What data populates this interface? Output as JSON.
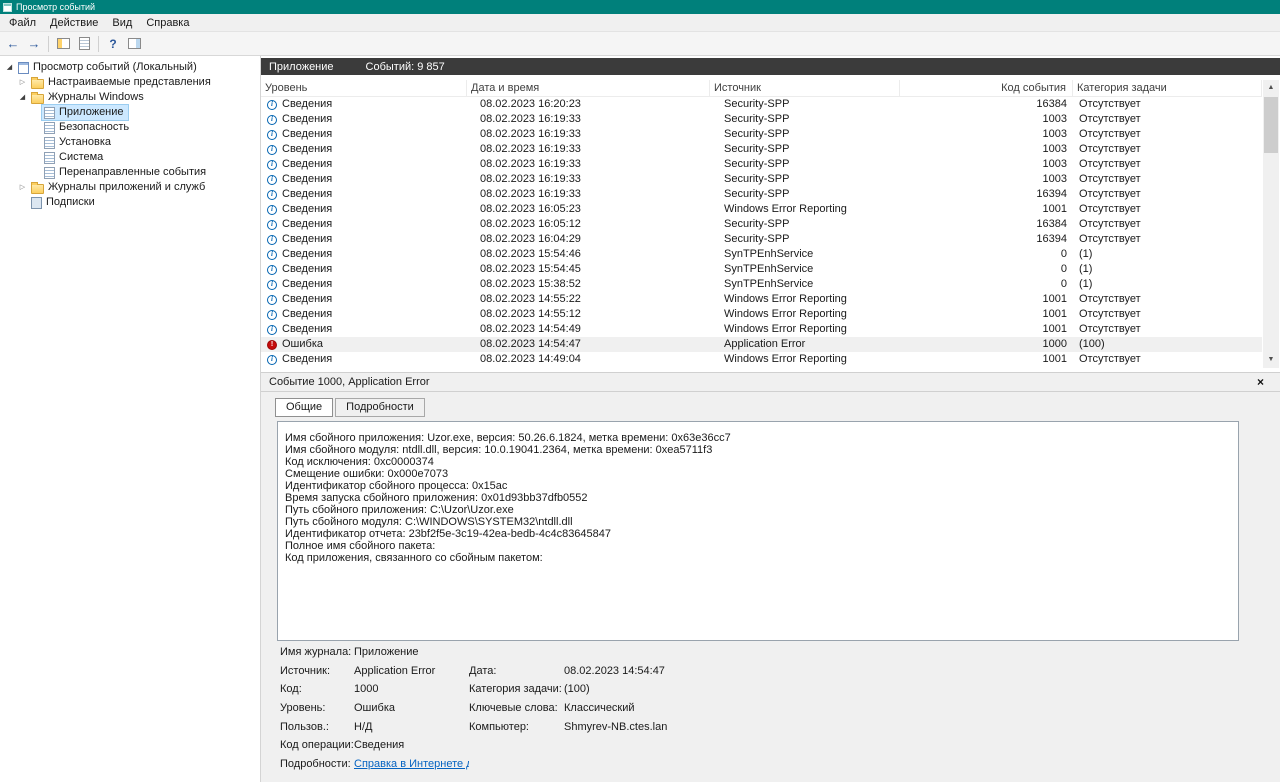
{
  "window": {
    "title": "Просмотр событий"
  },
  "colors": {
    "titlebar": "#00807b",
    "log_header_bar": "#3b3b3b",
    "tree_selection": "#cce8ff",
    "row_selection": "#f0f0f0",
    "link": "#0563c1",
    "error_icon": "#c50b0b",
    "info_icon": "#0063b1"
  },
  "menu": {
    "items": [
      {
        "id": "file",
        "label": "Файл"
      },
      {
        "id": "action",
        "label": "Действие"
      },
      {
        "id": "view",
        "label": "Вид"
      },
      {
        "id": "help",
        "label": "Справка"
      }
    ]
  },
  "toolbar": {
    "buttons": [
      "back",
      "forward",
      "show-console-tree",
      "properties",
      "help",
      "action-pane"
    ]
  },
  "sidebar": {
    "items": [
      {
        "id": "root",
        "label": "Просмотр событий (Локальный)",
        "indent": 0,
        "expander": "expanded",
        "icon": "event-viewer",
        "selected": false
      },
      {
        "id": "custom-views",
        "label": "Настраиваемые представления",
        "indent": 1,
        "expander": "collapsed",
        "icon": "folder",
        "selected": false
      },
      {
        "id": "windows-logs",
        "label": "Журналы Windows",
        "indent": 1,
        "expander": "expanded",
        "icon": "folder",
        "selected": false
      },
      {
        "id": "application",
        "label": "Приложение",
        "indent": 2,
        "expander": "none",
        "icon": "log",
        "selected": true
      },
      {
        "id": "security",
        "label": "Безопасность",
        "indent": 2,
        "expander": "none",
        "icon": "log",
        "selected": false
      },
      {
        "id": "setup",
        "label": "Установка",
        "indent": 2,
        "expander": "none",
        "icon": "log",
        "selected": false
      },
      {
        "id": "system",
        "label": "Система",
        "indent": 2,
        "expander": "none",
        "icon": "log",
        "selected": false
      },
      {
        "id": "forwarded-events",
        "label": "Перенаправленные события",
        "indent": 2,
        "expander": "none",
        "icon": "log",
        "selected": false
      },
      {
        "id": "apps-services-logs",
        "label": "Журналы приложений и служб",
        "indent": 1,
        "expander": "collapsed",
        "icon": "folder",
        "selected": false
      },
      {
        "id": "subscriptions",
        "label": "Подписки",
        "indent": 1,
        "expander": "none",
        "icon": "subscriptions",
        "selected": false
      }
    ]
  },
  "main": {
    "log_title": "Приложение",
    "events_count": "Событий: 9 857",
    "columns": [
      "Уровень",
      "Дата и время",
      "Источник",
      "Код события",
      "Категория задачи"
    ],
    "rows": [
      {
        "level": "Сведения",
        "icon": "info",
        "datetime": "08.02.2023 16:20:23",
        "source": "Security-SPP",
        "event_id": "16384",
        "category": "Отсутствует",
        "selected": false
      },
      {
        "level": "Сведения",
        "icon": "info",
        "datetime": "08.02.2023 16:19:33",
        "source": "Security-SPP",
        "event_id": "1003",
        "category": "Отсутствует",
        "selected": false
      },
      {
        "level": "Сведения",
        "icon": "info",
        "datetime": "08.02.2023 16:19:33",
        "source": "Security-SPP",
        "event_id": "1003",
        "category": "Отсутствует",
        "selected": false
      },
      {
        "level": "Сведения",
        "icon": "info",
        "datetime": "08.02.2023 16:19:33",
        "source": "Security-SPP",
        "event_id": "1003",
        "category": "Отсутствует",
        "selected": false
      },
      {
        "level": "Сведения",
        "icon": "info",
        "datetime": "08.02.2023 16:19:33",
        "source": "Security-SPP",
        "event_id": "1003",
        "category": "Отсутствует",
        "selected": false
      },
      {
        "level": "Сведения",
        "icon": "info",
        "datetime": "08.02.2023 16:19:33",
        "source": "Security-SPP",
        "event_id": "1003",
        "category": "Отсутствует",
        "selected": false
      },
      {
        "level": "Сведения",
        "icon": "info",
        "datetime": "08.02.2023 16:19:33",
        "source": "Security-SPP",
        "event_id": "16394",
        "category": "Отсутствует",
        "selected": false
      },
      {
        "level": "Сведения",
        "icon": "info",
        "datetime": "08.02.2023 16:05:23",
        "source": "Windows Error Reporting",
        "event_id": "1001",
        "category": "Отсутствует",
        "selected": false
      },
      {
        "level": "Сведения",
        "icon": "info",
        "datetime": "08.02.2023 16:05:12",
        "source": "Security-SPP",
        "event_id": "16384",
        "category": "Отсутствует",
        "selected": false
      },
      {
        "level": "Сведения",
        "icon": "info",
        "datetime": "08.02.2023 16:04:29",
        "source": "Security-SPP",
        "event_id": "16394",
        "category": "Отсутствует",
        "selected": false
      },
      {
        "level": "Сведения",
        "icon": "info",
        "datetime": "08.02.2023 15:54:46",
        "source": "SynTPEnhService",
        "event_id": "0",
        "category": "(1)",
        "selected": false
      },
      {
        "level": "Сведения",
        "icon": "info",
        "datetime": "08.02.2023 15:54:45",
        "source": "SynTPEnhService",
        "event_id": "0",
        "category": "(1)",
        "selected": false
      },
      {
        "level": "Сведения",
        "icon": "info",
        "datetime": "08.02.2023 15:38:52",
        "source": "SynTPEnhService",
        "event_id": "0",
        "category": "(1)",
        "selected": false
      },
      {
        "level": "Сведения",
        "icon": "info",
        "datetime": "08.02.2023 14:55:22",
        "source": "Windows Error Reporting",
        "event_id": "1001",
        "category": "Отсутствует",
        "selected": false
      },
      {
        "level": "Сведения",
        "icon": "info",
        "datetime": "08.02.2023 14:55:12",
        "source": "Windows Error Reporting",
        "event_id": "1001",
        "category": "Отсутствует",
        "selected": false
      },
      {
        "level": "Сведения",
        "icon": "info",
        "datetime": "08.02.2023 14:54:49",
        "source": "Windows Error Reporting",
        "event_id": "1001",
        "category": "Отсутствует",
        "selected": false
      },
      {
        "level": "Ошибка",
        "icon": "error",
        "datetime": "08.02.2023 14:54:47",
        "source": "Application Error",
        "event_id": "1000",
        "category": "(100)",
        "selected": true
      },
      {
        "level": "Сведения",
        "icon": "info",
        "datetime": "08.02.2023 14:49:04",
        "source": "Windows Error Reporting",
        "event_id": "1001",
        "category": "Отсутствует",
        "selected": false
      }
    ]
  },
  "detail": {
    "header": "Событие 1000, Application Error",
    "tabs": [
      {
        "id": "general",
        "label": "Общие",
        "active": true
      },
      {
        "id": "details",
        "label": "Подробности",
        "active": false
      }
    ],
    "description_lines": [
      "Имя сбойного приложения: Uzor.exe, версия: 50.26.6.1824, метка времени: 0x63e36cc7",
      "Имя сбойного модуля: ntdll.dll, версия: 10.0.19041.2364, метка времени: 0xea5711f3",
      "Код исключения: 0xc0000374",
      "Смещение ошибки: 0x000e7073",
      "Идентификатор сбойного процесса: 0x15ac",
      "Время запуска сбойного приложения: 0x01d93bb37dfb0552",
      "Путь сбойного приложения: C:\\Uzor\\Uzor.exe",
      "Путь сбойного модуля: C:\\WINDOWS\\SYSTEM32\\ntdll.dll",
      "Идентификатор отчета: 23bf2f5e-3c19-42ea-bedb-4c4c83645847",
      "Полное имя сбойного пакета:",
      "Код приложения, связанного со сбойным пакетом:"
    ],
    "fields": [
      {
        "label": "Имя журнала:",
        "value": "Приложение",
        "label2": "",
        "value2": "",
        "link": false
      },
      {
        "label": "Источник:",
        "value": "Application Error",
        "label2": "Дата:",
        "value2": "08.02.2023 14:54:47",
        "link": false
      },
      {
        "label": "Код:",
        "value": "1000",
        "label2": "Категория задачи:",
        "value2": "(100)",
        "link": false
      },
      {
        "label": "Уровень:",
        "value": "Ошибка",
        "label2": "Ключевые слова:",
        "value2": "Классический",
        "link": false
      },
      {
        "label": "Пользов.:",
        "value": "Н/Д",
        "label2": "Компьютер:",
        "value2": "Shmyrev-NB.ctes.lan",
        "link": false
      },
      {
        "label": "Код операции:",
        "value": "Сведения",
        "label2": "",
        "value2": "",
        "link": false
      },
      {
        "label": "Подробности:",
        "value": "Справка в Интернете для ",
        "label2": "",
        "value2": "",
        "link": true
      }
    ]
  }
}
